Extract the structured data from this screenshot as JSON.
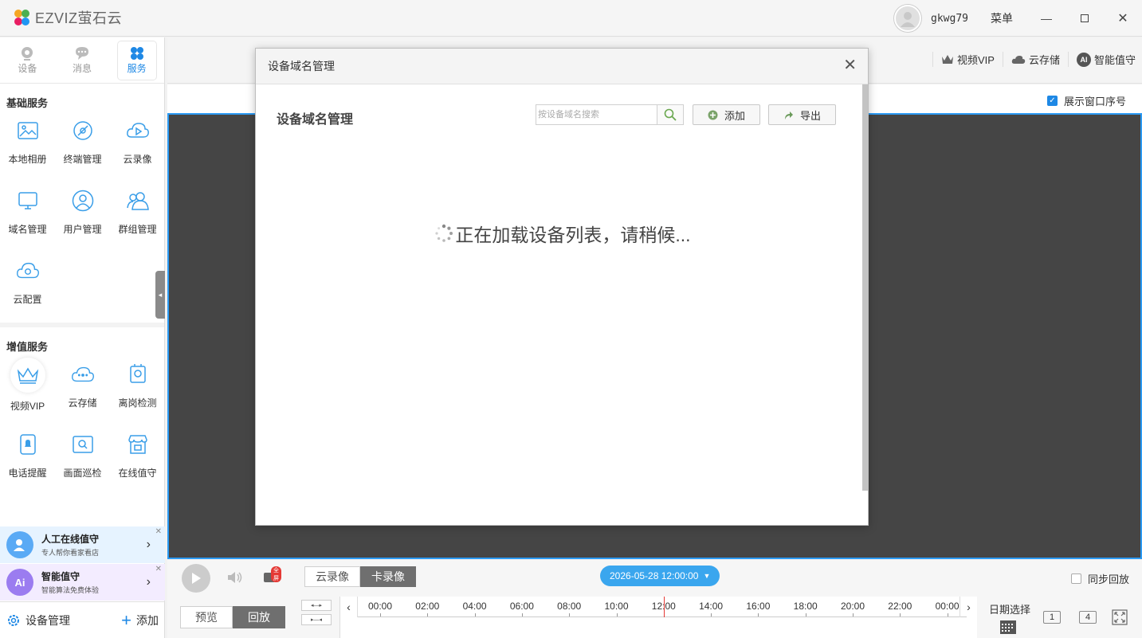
{
  "app": {
    "logo_text": "EZVIZ萤石云",
    "username": "gkwg79",
    "menu_label": "菜单"
  },
  "sidebar": {
    "tabs": [
      {
        "label": "设备",
        "icon": "camera-icon",
        "active": false
      },
      {
        "label": "消息",
        "icon": "message-icon",
        "active": false
      },
      {
        "label": "服务",
        "icon": "grid-icon",
        "active": true
      }
    ],
    "basic_title": "基础服务",
    "basic_items": [
      {
        "label": "本地相册",
        "icon": "image-icon"
      },
      {
        "label": "终端管理",
        "icon": "satellite-icon"
      },
      {
        "label": "云录像",
        "icon": "cloud-play-icon"
      },
      {
        "label": "域名管理",
        "icon": "monitor-icon"
      },
      {
        "label": "用户管理",
        "icon": "user-icon"
      },
      {
        "label": "群组管理",
        "icon": "group-icon"
      },
      {
        "label": "云配置",
        "icon": "cloud-gear-icon"
      }
    ],
    "value_title": "增值服务",
    "value_items": [
      {
        "label": "视频VIP",
        "icon": "crown-icon"
      },
      {
        "label": "云存储",
        "icon": "cloud-storage-icon"
      },
      {
        "label": "离岗检测",
        "icon": "badge-icon"
      },
      {
        "label": "电话提醒",
        "icon": "phone-bell-icon"
      },
      {
        "label": "画面巡检",
        "icon": "screen-search-icon"
      },
      {
        "label": "在线值守",
        "icon": "store-icon"
      }
    ],
    "promo1": {
      "title": "人工在线值守",
      "sub": "专人帮你看家看店"
    },
    "promo2": {
      "title": "智能值守",
      "sub": "智能算法免费体验",
      "icon_text": "Ai"
    },
    "device_manage": "设备管理",
    "add": "添加"
  },
  "toolbar": {
    "vip": "视频VIP",
    "cloud": "云存储",
    "ai": "智能值守",
    "ai_badge": "AI",
    "show_index": "展示窗口序号"
  },
  "player": {
    "fullscreen_badge": "全屏",
    "cloud_record": "云录像",
    "card_record": "卡录像",
    "datetime": "2026-05-28 12:00:00",
    "sync_playback": "同步回放",
    "preview": "预览",
    "playback": "回放",
    "ticks": [
      "00:00",
      "02:00",
      "04:00",
      "06:00",
      "08:00",
      "10:00",
      "12:00",
      "14:00",
      "16:00",
      "18:00",
      "20:00",
      "22:00",
      "00:00"
    ],
    "date_select": "日期选择",
    "layout1": "1",
    "layout4": "4"
  },
  "modal": {
    "header": "设备域名管理",
    "title": "设备域名管理",
    "search_placeholder": "按设备域名搜索",
    "add": "添加",
    "export": "导出",
    "loading": "正在加载设备列表，请稍候..."
  }
}
